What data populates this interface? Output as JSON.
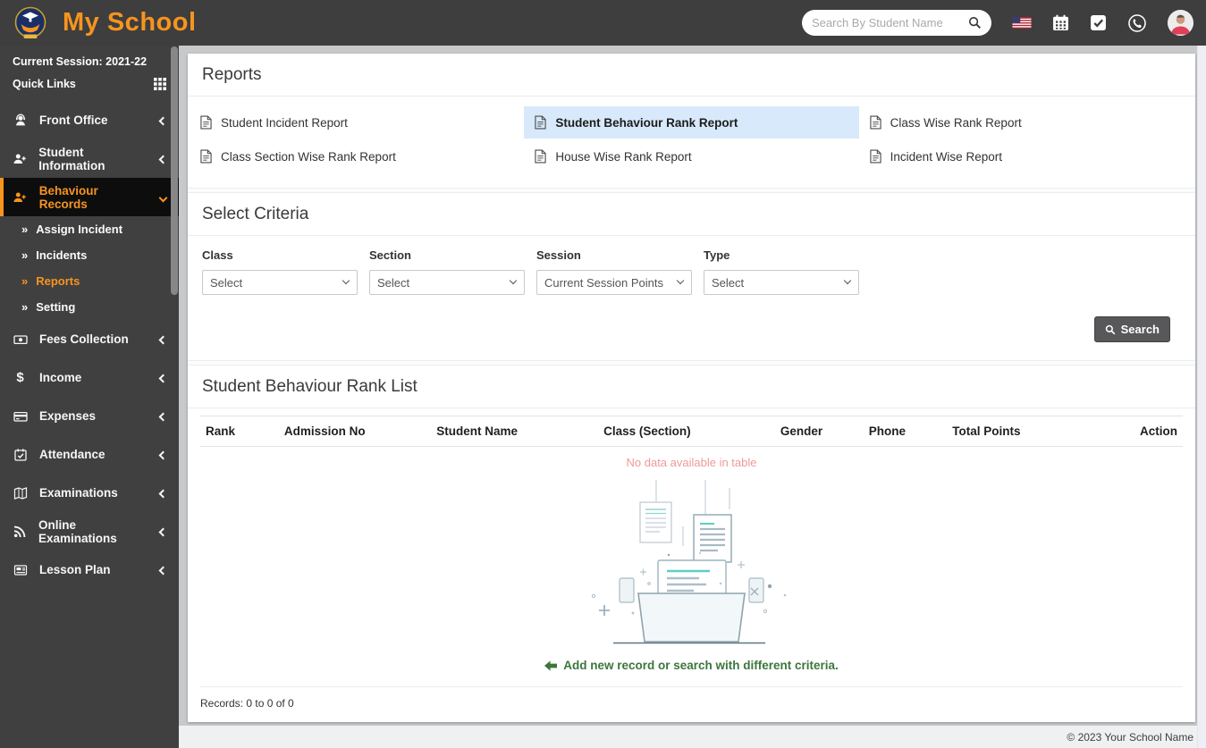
{
  "header": {
    "brand": "My School",
    "search_placeholder": "Search By Student Name",
    "icons": [
      {
        "name": "search-icon"
      },
      {
        "name": "us-flag-icon"
      },
      {
        "name": "calendar-icon"
      },
      {
        "name": "tasks-check-icon"
      },
      {
        "name": "whatsapp-icon"
      },
      {
        "name": "user-avatar"
      }
    ]
  },
  "sidebar": {
    "session_label": "Current Session: 2021-22",
    "quick_links_label": "Quick Links",
    "items": [
      {
        "label": "Front Office",
        "icon": "front-office-icon",
        "state": "collapsed"
      },
      {
        "label": "Student Information",
        "icon": "student-information-icon",
        "state": "collapsed"
      },
      {
        "label": "Behaviour Records",
        "icon": "behaviour-records-icon",
        "state": "expanded",
        "active": true,
        "children": [
          {
            "label": "Assign Incident"
          },
          {
            "label": "Incidents"
          },
          {
            "label": "Reports",
            "active": true
          },
          {
            "label": "Setting"
          }
        ]
      },
      {
        "label": "Fees Collection",
        "icon": "fees-collection-icon",
        "state": "collapsed"
      },
      {
        "label": "Income",
        "icon": "income-icon",
        "state": "collapsed"
      },
      {
        "label": "Expenses",
        "icon": "expenses-icon",
        "state": "collapsed"
      },
      {
        "label": "Attendance",
        "icon": "attendance-icon",
        "state": "collapsed"
      },
      {
        "label": "Examinations",
        "icon": "examinations-icon",
        "state": "collapsed"
      },
      {
        "label": "Online Examinations",
        "icon": "online-examinations-icon",
        "state": "collapsed"
      },
      {
        "label": "Lesson Plan",
        "icon": "lesson-plan-icon",
        "state": "collapsed"
      }
    ]
  },
  "reports_panel": {
    "title": "Reports",
    "items": [
      {
        "label": "Student Incident Report",
        "active": false
      },
      {
        "label": "Student Behaviour Rank Report",
        "active": true
      },
      {
        "label": "Class Wise Rank Report",
        "active": false
      },
      {
        "label": "Class Section Wise Rank Report",
        "active": false
      },
      {
        "label": "House Wise Rank Report",
        "active": false
      },
      {
        "label": "Incident Wise Report",
        "active": false
      }
    ]
  },
  "criteria": {
    "title": "Select Criteria",
    "fields": [
      {
        "label": "Class",
        "value": "Select"
      },
      {
        "label": "Section",
        "value": "Select"
      },
      {
        "label": "Session",
        "value": "Current Session Points"
      },
      {
        "label": "Type",
        "value": "Select"
      }
    ],
    "search_button": "Search"
  },
  "rank_list": {
    "title": "Student Behaviour Rank List",
    "columns": [
      "Rank",
      "Admission No",
      "Student Name",
      "Class (Section)",
      "Gender",
      "Phone",
      "Total Points",
      "Action"
    ],
    "empty_text": "No data available in table",
    "empty_hint": "Add new record or search with different criteria.",
    "records_text": "Records: 0 to 0 of 0"
  },
  "footer": {
    "copyright": "© 2023 Your School Name"
  },
  "colors": {
    "accent_orange": "#f7941e",
    "header_bg": "#3e3e3e",
    "sidebar_bg": "#404040",
    "active_report_bg": "#d7e9fa",
    "no_data_pink": "#ef9a9a",
    "hint_green": "#3c763d"
  }
}
